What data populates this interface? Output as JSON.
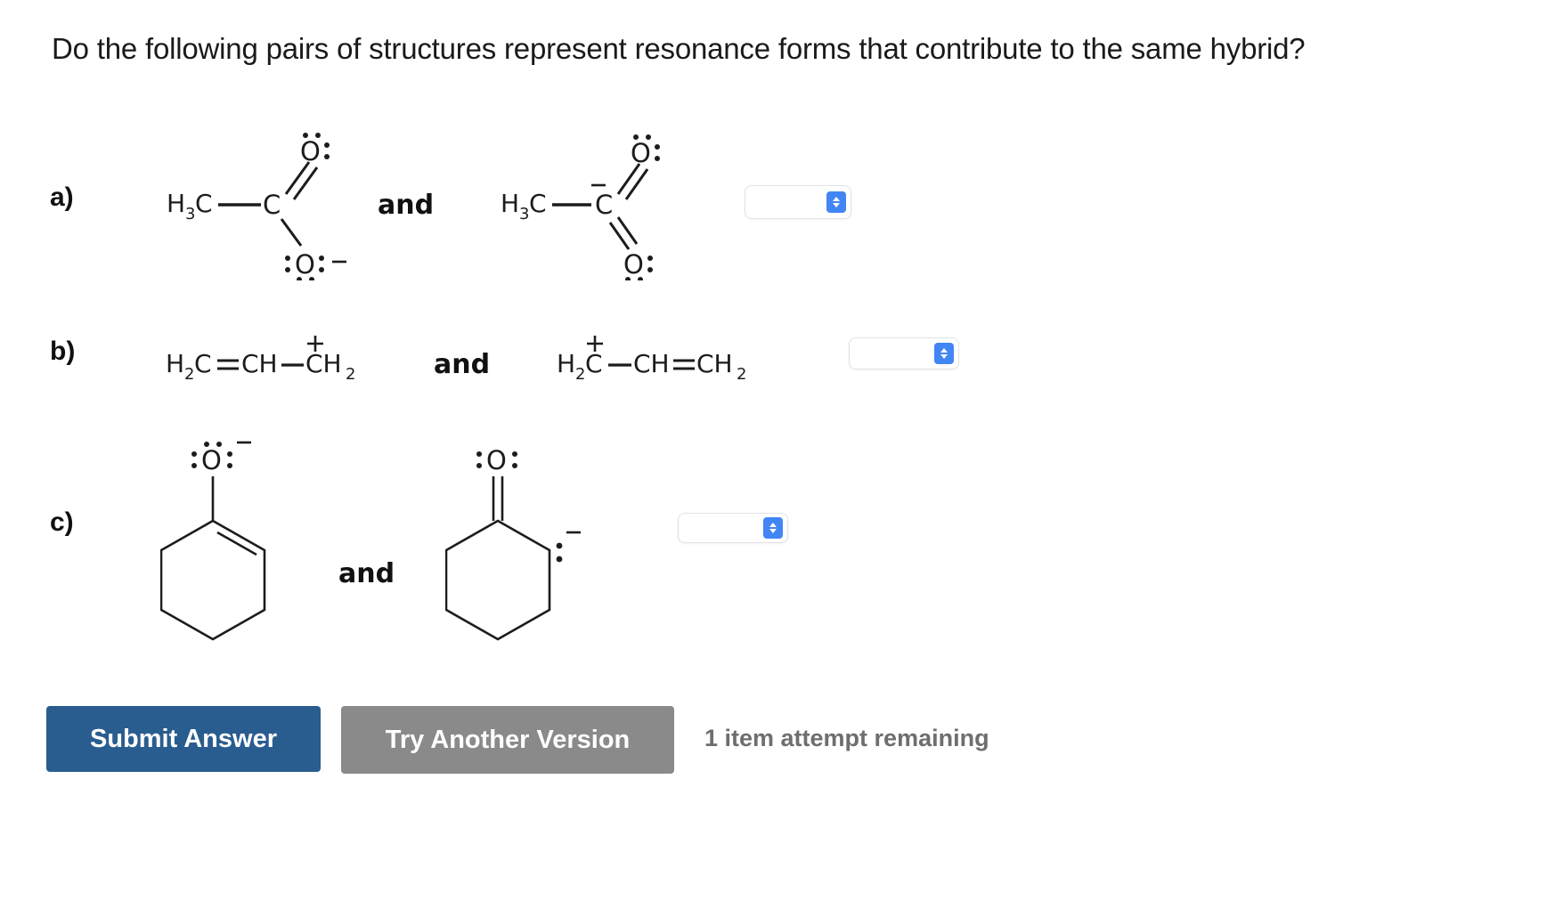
{
  "question": {
    "prompt": "Do the following pairs of structures represent resonance forms that contribute to the same hybrid?"
  },
  "parts": [
    {
      "label": "a)",
      "conjunction": "and",
      "left_structure": {
        "name": "acetate-resonance-form-1",
        "description": "H3C-C(=O:)(-O:-)",
        "atoms": [
          "H3C",
          "C",
          "O",
          "O"
        ],
        "charge": "−",
        "charge_on": "lower-oxygen"
      },
      "right_structure": {
        "name": "acetate-resonance-form-2",
        "description": "H3C-C(-)(=O:)(=O:)",
        "atoms": [
          "H3C",
          "C",
          "O",
          "O"
        ],
        "charge": "−",
        "charge_on": "central-carbon"
      },
      "dropdown": {
        "value": "",
        "placeholder": ""
      }
    },
    {
      "label": "b)",
      "conjunction": "and",
      "left_formula": "H2C=CH—CH2",
      "left_charge": "+",
      "right_formula": "H2C—CH=CH2",
      "right_charge": "+",
      "dropdown": {
        "value": "",
        "placeholder": ""
      }
    },
    {
      "label": "c)",
      "conjunction": "and",
      "left_structure": {
        "name": "cyclohexenolate",
        "description": "cyclohexene ring with O(-) substituent",
        "oxygen_label": "O",
        "charge": "−"
      },
      "right_structure": {
        "name": "cyclohexanone-carbanion",
        "description": "cyclohexanone ring with carbanion at alpha carbon",
        "oxygen_label": "O",
        "charge": "−"
      },
      "dropdown": {
        "value": "",
        "placeholder": ""
      }
    }
  ],
  "footer": {
    "submit_label": "Submit Answer",
    "another_version_label": "Try Another Version",
    "attempts_text": "1 item attempt remaining",
    "submit_color": "#2a5d8f",
    "another_color": "#8a8a8a",
    "attempts_color": "#6e6e6e"
  },
  "icons": {
    "dropdown_arrows": "chevron-up-down-icon"
  }
}
